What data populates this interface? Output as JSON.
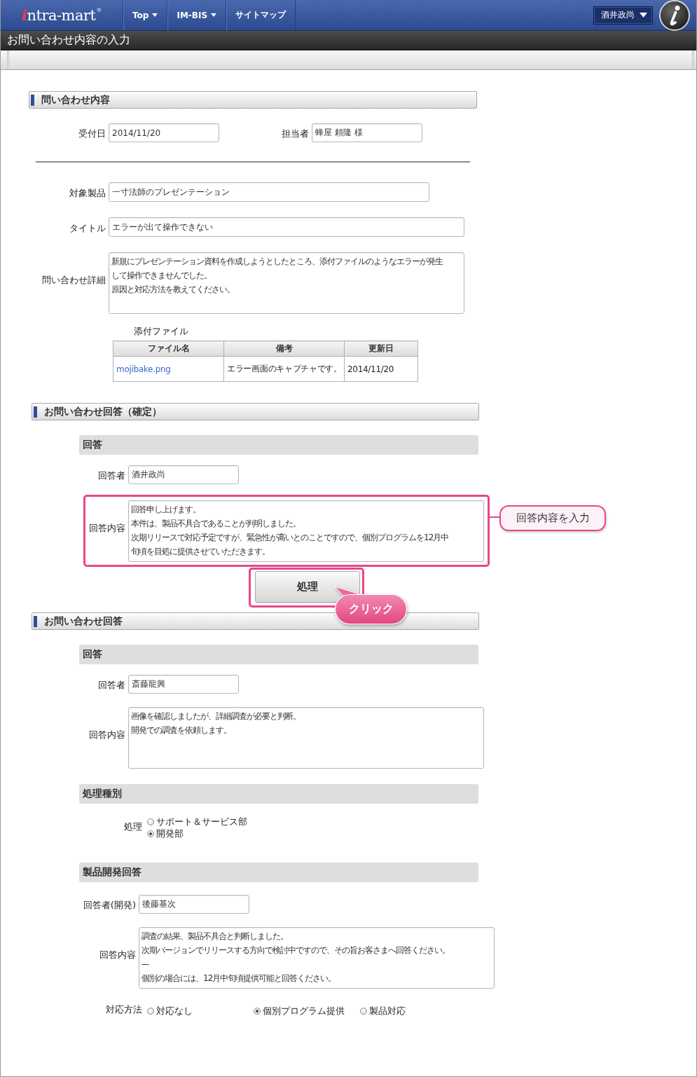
{
  "header": {
    "logo": "intra-mart$^{®}$",
    "nav": [
      {
        "label": "Top",
        "dropdown": true
      },
      {
        "label": "IM-BIS",
        "dropdown": true
      },
      {
        "label": "サイトマップ",
        "dropdown": false
      }
    ],
    "user_menu": "酒井政尚"
  },
  "page_title": "お問い合わせ内容の入力",
  "inquiry": {
    "title": "問い合わせ内容",
    "received_date": {
      "label": "受付日",
      "value": "2014/11/20"
    },
    "assignee": {
      "label": "担当者",
      "value": "蜂屋 頼隆 様"
    },
    "fields": [
      {
        "kind": "input",
        "label": "対象製品",
        "value": "一寸法師のプレゼンテーション"
      },
      {
        "kind": "input",
        "label": "タイトル",
        "value": "エラーが出て操作できない"
      },
      {
        "kind": "textarea",
        "label": "問い合わせ詳細",
        "lines": [
          "新規にプレゼンテーション資料を作成しようとしたところ、添付ファイルのようなエラーが発生して操作できませんでした。",
          "原因と対応方法を教えてください。"
        ]
      }
    ],
    "attachments": {
      "label": "添付ファイル",
      "columns": [
        "ファイル名",
        "備考",
        "更新日"
      ],
      "rows": [
        {
          "file": "mojibake.png",
          "note": "エラー画面のキャプチャです。",
          "updated": "2014/11/20"
        }
      ]
    }
  },
  "confirmed_answer": {
    "title": "お問い合わせ回答（確定）",
    "subtitle": "回答",
    "responder": {
      "label": "回答者",
      "value": "酒井政尚"
    },
    "content": {
      "label": "回答内容",
      "lines": [
        "回答申し上げます。",
        "本件は、製品不具合であることが判明しました。",
        "次期リリースで対応予定ですが、緊急性が高いとのことですので、個別プログラムを12月中旬頃を目処に提供させていただきます。"
      ],
      "highlighted": true
    },
    "content_callout": "回答内容を入力",
    "submit": {
      "label": "処理",
      "highlighted": true
    },
    "submit_callout": "クリック"
  },
  "answer": {
    "title": "お問い合わせ回答",
    "reply": {
      "subtitle": "回答",
      "responder": {
        "label": "回答者",
        "value": "斎藤龍興"
      },
      "content": {
        "label": "回答内容",
        "lines": [
          "画像を確認しましたが、詳細調査が必要と判断。",
          "開発での調査を依頼します。"
        ]
      }
    },
    "process_type": {
      "subtitle": "処理種別",
      "label": "処理",
      "options": [
        {
          "label": "サポート＆サービス部",
          "selected": false
        },
        {
          "label": "開発部",
          "selected": true
        }
      ]
    },
    "dev_reply": {
      "subtitle": "製品開発回答",
      "responder": {
        "label": "回答者(開発)",
        "value": "後藤基次"
      },
      "content": {
        "label": "回答内容",
        "lines": [
          "調査の結果、製品不具合と判断しました。",
          "次期バージョンでリリースする方向で検討中ですので、その旨お客さまへ回答ください。",
          "---",
          "個別の場合には、12月中旬頃提供可能と回答ください。"
        ]
      },
      "method": {
        "label": "対応方法",
        "options": [
          {
            "label": "対応なし",
            "selected": false
          },
          {
            "label": "個別プログラム提供",
            "selected": true
          },
          {
            "label": "製品対応",
            "selected": false
          }
        ]
      }
    }
  }
}
